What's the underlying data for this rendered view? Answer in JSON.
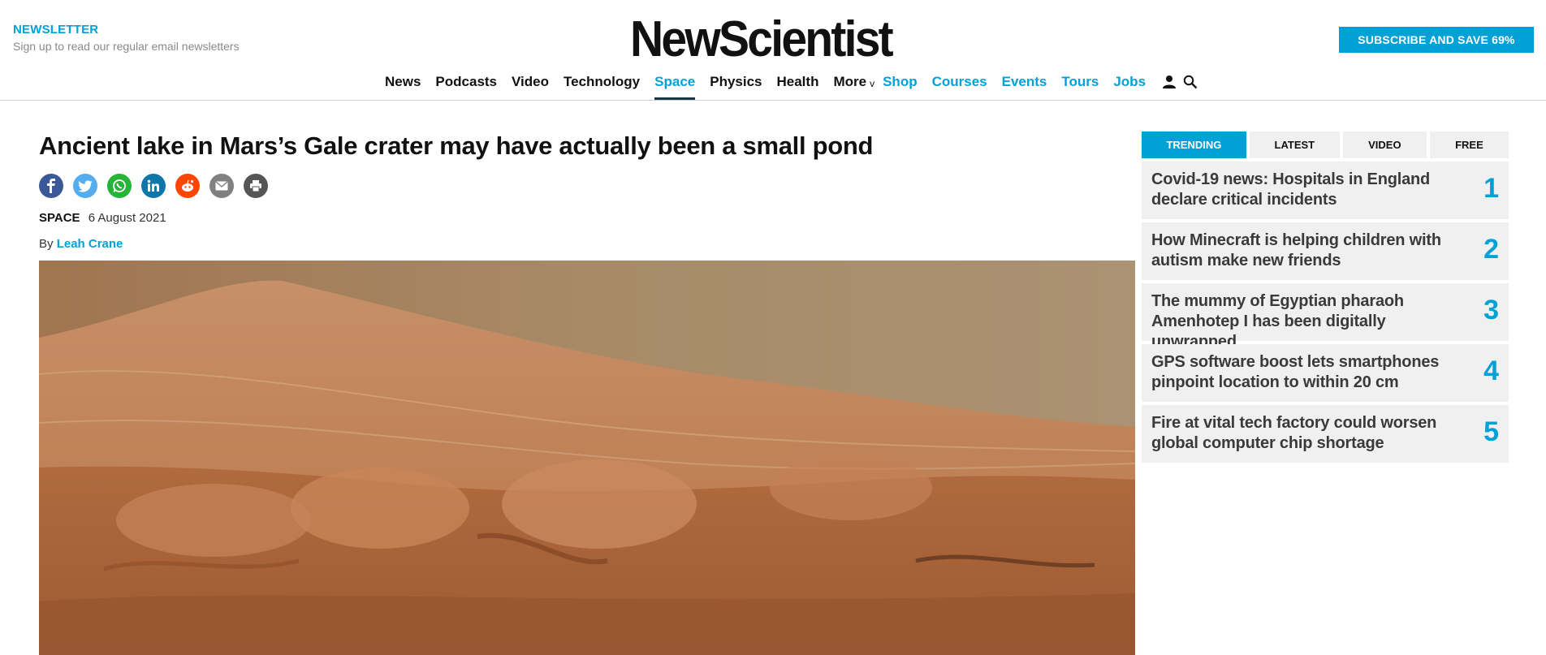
{
  "header": {
    "newsletter_title": "NEWSLETTER",
    "newsletter_sub": "Sign up to read our regular email newsletters",
    "logo_text": "NewScientist",
    "subscribe_label": "SUBSCRIBE AND SAVE 69%"
  },
  "nav": {
    "items": [
      "News",
      "Podcasts",
      "Video",
      "Technology",
      "Space",
      "Physics",
      "Health",
      "More"
    ],
    "more_chevron": "v",
    "links": [
      "Shop",
      "Courses",
      "Events",
      "Tours",
      "Jobs"
    ],
    "active": "Space",
    "icons": [
      "account-icon",
      "search-icon"
    ]
  },
  "article": {
    "headline": "Ancient lake in Mars’s Gale crater may have actually been a small pond",
    "section": "SPACE",
    "date": "6 August 2021",
    "by": "By",
    "author": "Leah Crane",
    "share_icons": [
      "facebook-icon",
      "twitter-icon",
      "whatsapp-icon",
      "linkedin-icon",
      "reddit-icon",
      "email-icon",
      "print-icon"
    ],
    "share_colors": [
      "#3b5998",
      "#55acee",
      "#25b33a",
      "#0e76a8",
      "#ff4500",
      "#808080",
      "#555555"
    ]
  },
  "sidebar": {
    "tabs": [
      "TRENDING",
      "LATEST",
      "VIDEO",
      "FREE"
    ],
    "active_tab": "TRENDING",
    "trending": [
      {
        "title": "Covid-19 news: Hospitals in England declare critical incidents",
        "rank": "1"
      },
      {
        "title": "How Minecraft is helping children with autism make new friends",
        "rank": "2"
      },
      {
        "title": "The mummy of Egyptian pharaoh Amenhotep I has been digitally unwrapped",
        "rank": "3"
      },
      {
        "title": "GPS software boost lets smartphones pinpoint location to within 20 cm",
        "rank": "4"
      },
      {
        "title": "Fire at vital tech factory could worsen global computer chip shortage",
        "rank": "5"
      }
    ]
  },
  "colors": {
    "accent": "#00a1d6",
    "nav_underline": "#173849",
    "sidebar_bg": "#f0f0f0"
  }
}
